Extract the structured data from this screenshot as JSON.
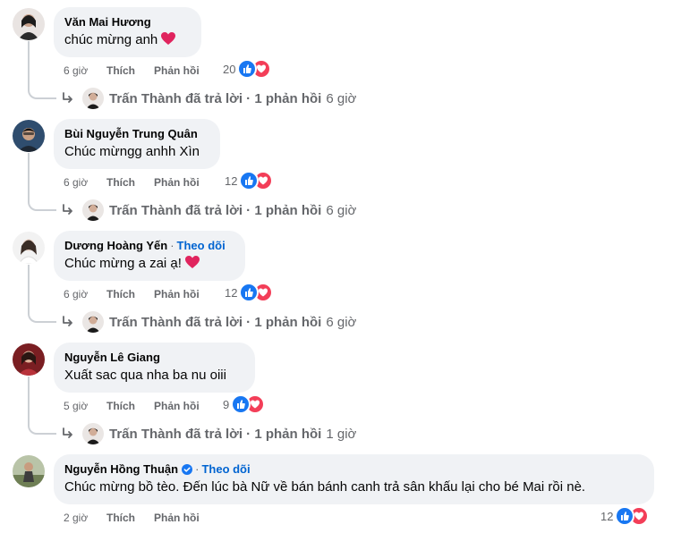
{
  "comments": [
    {
      "author": "Văn Mai Hương",
      "text": "chúc mừng anh",
      "follow": "",
      "time": "6 giờ",
      "like": "Thích",
      "reply": "Phản hồi",
      "reactions": "20",
      "has_reply": true,
      "reply_text": "Trấn Thành đã trả lời · 1 phản hồi",
      "reply_time": "6 giờ"
    },
    {
      "author": "Bùi Nguyễn Trung Quân",
      "text": "Chúc mừngg anhh Xìn",
      "follow": "",
      "time": "6 giờ",
      "like": "Thích",
      "reply": "Phản hồi",
      "reactions": "12",
      "has_reply": true,
      "reply_text": "Trấn Thành đã trả lời · 1 phản hồi",
      "reply_time": "6 giờ"
    },
    {
      "author": "Dương Hoàng Yến",
      "text": "Chúc mừng a zai ạ!",
      "follow": "Theo dõi",
      "time": "6 giờ",
      "like": "Thích",
      "reply": "Phản hồi",
      "reactions": "12",
      "has_reply": true,
      "reply_text": "Trấn Thành đã trả lời · 1 phản hồi",
      "reply_time": "6 giờ"
    },
    {
      "author": "Nguyễn Lê Giang",
      "text": "Xuất sac qua nha ba nu oiii",
      "follow": "",
      "time": "5 giờ",
      "like": "Thích",
      "reply": "Phản hồi",
      "reactions": "9",
      "has_reply": true,
      "reply_text": "Trấn Thành đã trả lời · 1 phản hồi",
      "reply_time": "1 giờ"
    },
    {
      "author": "Nguyễn Hồng Thuận",
      "text": "Chúc mừng bồ tèo. Đến lúc bà Nữ về bán bánh canh trả sân khấu lại cho bé Mai rồi nè.",
      "follow": "Theo dõi",
      "time": "2 giờ",
      "like": "Thích",
      "reply": "Phản hồi",
      "reactions": "12",
      "has_reply": false,
      "reply_text": "",
      "reply_time": ""
    }
  ],
  "colors": {
    "bubble": "#f0f2f5",
    "like": "#1877f2",
    "love": "#f33e58",
    "link": "#0064d1",
    "meta": "#65676b"
  }
}
